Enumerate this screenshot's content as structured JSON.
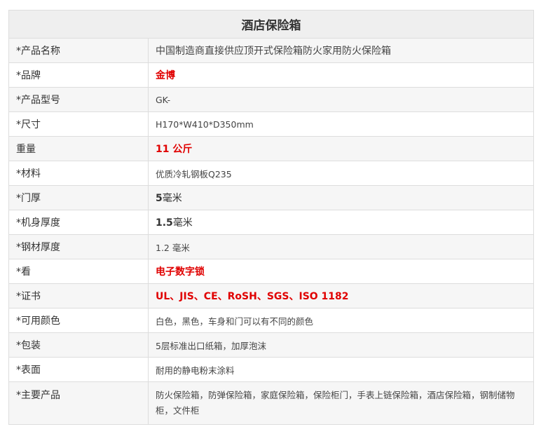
{
  "title": "酒店保险箱",
  "colors": {
    "accent_red": "#e00000",
    "border": "#dddddd",
    "header_bg": "#efefef",
    "row_alt_bg": "#f6f6f6"
  },
  "rows": [
    {
      "key": "*产品名称",
      "value": "中国制造商直接供应顶开式保险箱防火家用防火保险箱"
    },
    {
      "key": "*品牌",
      "value": "金博"
    },
    {
      "key": "*产品型号",
      "value": "GK-"
    },
    {
      "key": "*尺寸",
      "value": "H170*W410*D350mm"
    },
    {
      "key": "重量",
      "value": "11 公斤"
    },
    {
      "key": "*材料",
      "value": "优质冷轧钢板Q235"
    },
    {
      "key": "*门厚",
      "value_num": "5",
      "value_unit": "毫米"
    },
    {
      "key": "*机身厚度",
      "value_num": "1.5",
      "value_unit": "毫米"
    },
    {
      "key": "*钢材厚度",
      "value": "1.2 毫米"
    },
    {
      "key": "*看",
      "value": "电子数字锁"
    },
    {
      "key": "*证书",
      "value": "UL、JIS、CE、RoSH、SGS、ISO 1182"
    },
    {
      "key": "*可用颜色",
      "value": "白色，黑色，车身和门可以有不同的颜色"
    },
    {
      "key": "*包装",
      "value": "5层标准出口纸箱，加厚泡沫"
    },
    {
      "key": "*表面",
      "value": "耐用的静电粉末涂料"
    },
    {
      "key": "*主要产品",
      "value": "防火保险箱，防弹保险箱，家庭保险箱，保险柜门，手表上链保险箱，酒店保险箱，钢制储物柜，文件柜"
    }
  ]
}
